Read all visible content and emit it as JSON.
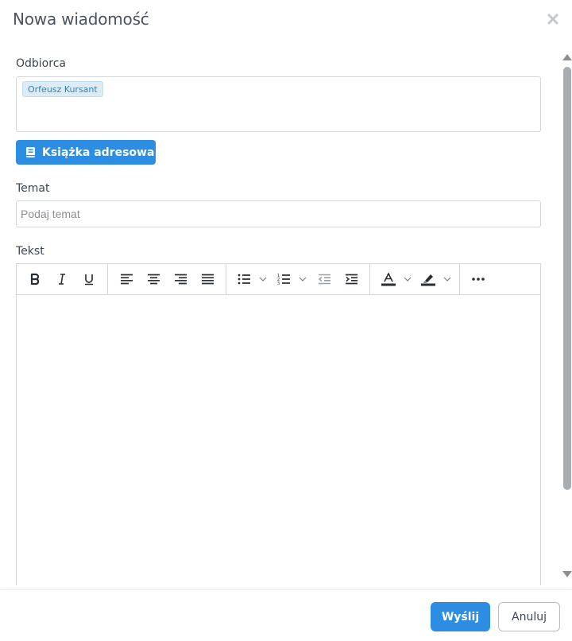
{
  "dialog": {
    "title": "Nowa wiadomość",
    "close_icon": "close-icon"
  },
  "form": {
    "recipient_label": "Odbiorca",
    "recipients": [
      "Orfeusz Kursant"
    ],
    "address_book_label": "Książka adresowa",
    "address_book_icon": "book-icon",
    "subject_label": "Temat",
    "subject_placeholder": "Podaj temat",
    "subject_value": "",
    "text_label": "Tekst",
    "text_value": ""
  },
  "toolbar": {
    "groups": [
      [
        "bold-icon",
        "italic-icon",
        "underline-icon"
      ],
      [
        "align-left-icon",
        "align-center-icon",
        "align-right-icon",
        "align-justify-icon"
      ],
      [
        "bulleted-list-icon",
        "numbered-list-icon",
        "outdent-icon",
        "indent-icon"
      ],
      [
        "font-color-icon",
        "highlight-icon"
      ],
      [
        "more-icon"
      ]
    ]
  },
  "footer": {
    "send_label": "Wyślij",
    "cancel_label": "Anuluj"
  },
  "colors": {
    "primary": "#2d8de3",
    "chip_bg": "#dcecf7",
    "chip_text": "#3d7fa6",
    "border": "#d4d7dc"
  }
}
